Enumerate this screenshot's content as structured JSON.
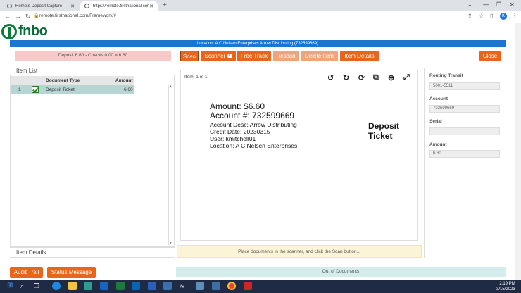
{
  "browser": {
    "tabs": [
      {
        "label": "Remote Deposit Capture"
      },
      {
        "label": "https://remote.firstnational.com"
      }
    ],
    "new_tab": "+",
    "url": "remote.firstnational.com/Framework/#",
    "profile_initial": "K"
  },
  "logo": {
    "text": "fnbo"
  },
  "location_bar": "Location: A C Nelsen Enterprises    Arrow Distributing (732599669)",
  "deposit_summary": "Deposit 6.60 - Checks 0.00 = 6.60",
  "toolbar": {
    "scan": "Scan",
    "scanner": "Scanner",
    "free_track": "Free Track",
    "rescan": "Rescan",
    "delete_item": "Delete Item",
    "item_details": "Item Details",
    "close": "Close"
  },
  "item_list": {
    "title": "Item List",
    "columns": {
      "type": "Document Type",
      "amount": "Amount"
    },
    "rows": [
      {
        "num": "1",
        "type": "Deposit Ticket",
        "amount": "6.60"
      }
    ]
  },
  "item_details_title": "Item Details",
  "viewer": {
    "item_label": "Item:  1  of  1",
    "amount": "Amount:  $6.60",
    "account": "Account #:  732599669",
    "account_desc": "Account Desc:  Arrow Distributing",
    "credit_date": "Credit Date:  20230315",
    "user": "User:  kmitchell01",
    "location": "Location:  A C Nelsen Enterprises",
    "ticket_label": "Deposit Ticket"
  },
  "fields": {
    "routing_label": "Routing Transit",
    "routing_value": "5001-5511",
    "account_label": "Account",
    "account_value": "732599669",
    "serial_label": "Serial",
    "serial_value": "",
    "amount_label": "Amount",
    "amount_value": "6.60"
  },
  "message": "Place documents in the scanner, and click the Scan button...",
  "footer": {
    "audit_trail": "Audit Trail",
    "status_message": "Status Message",
    "out_of_documents": "Out of Documents"
  },
  "clock": {
    "time": "2:19 PM",
    "date": "3/15/2023"
  },
  "colors": {
    "accent": "#e8661c",
    "blue": "#1976d2",
    "brand": "#0a6a38"
  }
}
